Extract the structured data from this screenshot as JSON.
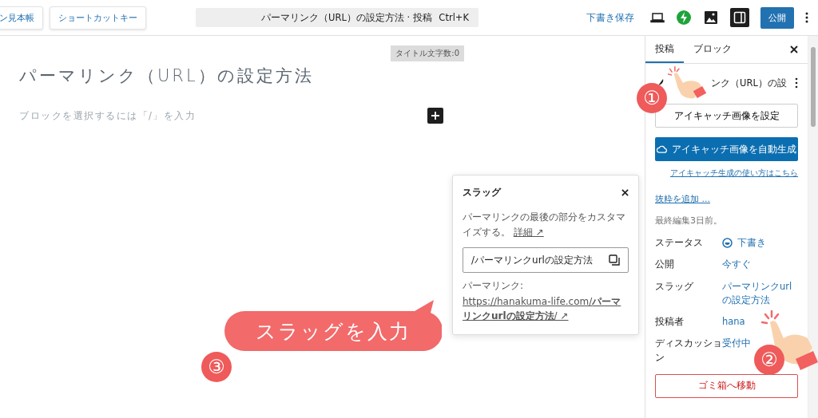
{
  "toolbar": {
    "left_buttons": [
      "ン見本帳",
      "ショートカットキー"
    ],
    "command_bar": {
      "title": "パーマリンク（URL）の設定方法 · 投稿",
      "shortcut": "Ctrl+K"
    },
    "save_draft": "下書き保存",
    "sidebar_toggle": {
      "selected": true
    },
    "publish": "公開"
  },
  "editor": {
    "title_count": "タイトル文字数:0",
    "title": "パーマリンク（URL）の設定方法",
    "block_placeholder": "ブロックを選択するには「/」を入力"
  },
  "slug_popover": {
    "title": "スラッグ",
    "description": "パーマリンクの最後の部分をカスタマイズする。",
    "more_link": "詳細 ↗",
    "slug_field": "/パーマリンクurlの設定方法",
    "permalink_label": "パーマリンク:",
    "url": "https://hanakuma-life.com/**パーマリンクurlの設定方法**/ ↗"
  },
  "sidebar": {
    "tabs": [
      {
        "label": "投稿",
        "selected": true
      },
      {
        "label": "ブロック",
        "selected": false
      }
    ],
    "post_title": "ンク（URL）の設",
    "featured_image_button": "アイキャッチ画像を設定",
    "auto_generate_button": "アイキャッチ画像を自動生成",
    "help_link": "アイキャッチ生成の使い方はこちら",
    "excerpt_link": "抜粋を追加 ...",
    "last_edited": "最終編集3日前。",
    "fields": [
      {
        "label": "ステータス",
        "value": "下書き",
        "kind": "status"
      },
      {
        "label": "公開",
        "value": "今すぐ",
        "kind": "text"
      },
      {
        "label": "スラッグ",
        "value": "パーマリンクurlの設定方法",
        "kind": "text"
      },
      {
        "label": "投稿者",
        "value": "hana",
        "kind": "text"
      },
      {
        "label": "ディスカッション",
        "value": "受付中",
        "kind": "text"
      }
    ],
    "trash_button": "ゴミ箱へ移動"
  },
  "annotations": {
    "steps": [
      "①",
      "②",
      "③"
    ],
    "callout": "スラッグを入力"
  }
}
